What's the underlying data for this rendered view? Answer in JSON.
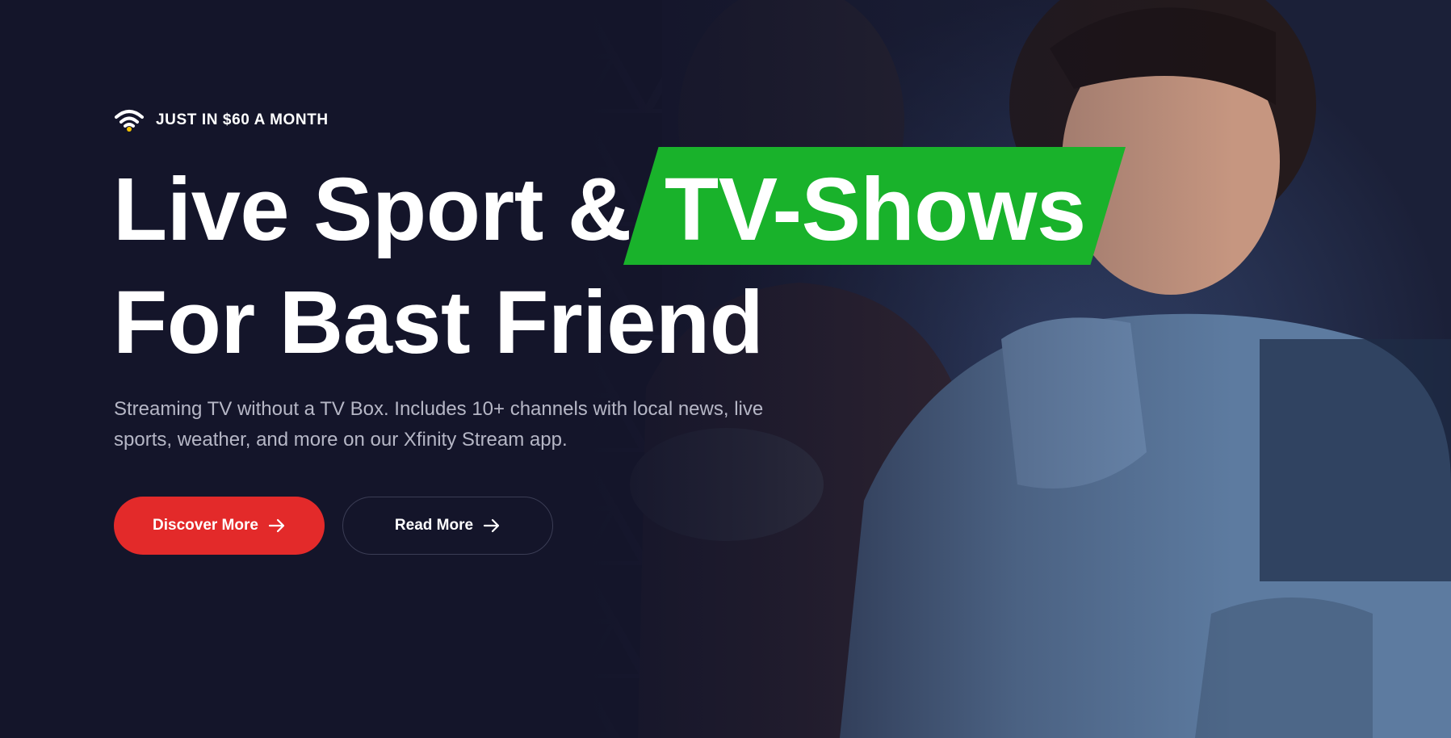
{
  "hero": {
    "eyebrow": {
      "icon": "wifi-icon",
      "text": "JUST IN $60 A MONTH"
    },
    "title": {
      "line1_before": "Live Sport &",
      "highlight": "TV-Shows",
      "line2": "For Bast Friend"
    },
    "description": "Streaming TV without a TV Box. Includes 10+ channels with local news, live sports, weather, and more on our Xfinity Stream app.",
    "buttons": {
      "primary": {
        "label": "Discover More",
        "icon": "arrow-right-icon"
      },
      "secondary": {
        "label": "Read More",
        "icon": "arrow-right-icon"
      }
    }
  },
  "colors": {
    "background": "#15162a",
    "highlight": "#19b22b",
    "primary_button": "#e32a2a",
    "eyebrow_accent": "#f5c400",
    "description_text": "#b6b7c6"
  }
}
